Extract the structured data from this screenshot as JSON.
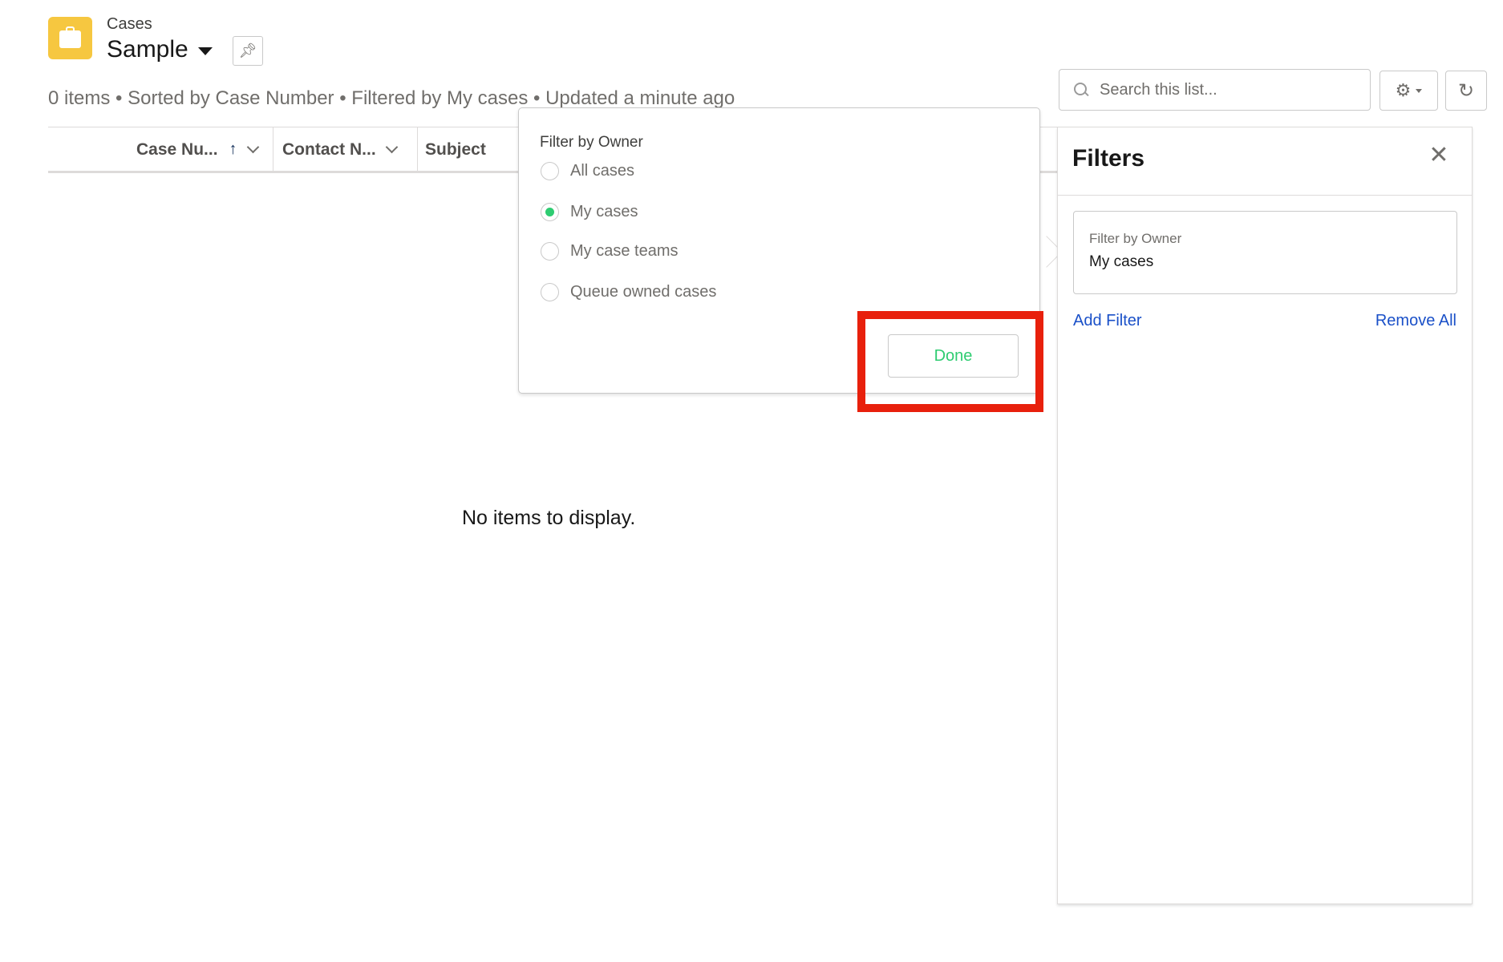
{
  "header": {
    "object_label": "Cases",
    "list_view_name": "Sample",
    "pin_icon": "pin-icon"
  },
  "meta": {
    "summary": "0 items • Sorted by Case Number • Filtered by My cases • Updated a minute ago"
  },
  "toolbar": {
    "search_placeholder": "Search this list...",
    "gear_icon": "gear-icon",
    "refresh_icon": "refresh-icon"
  },
  "table": {
    "columns": [
      {
        "label": "Case Nu...",
        "sorted": "ascending"
      },
      {
        "label": "Contact N..."
      },
      {
        "label": "Subject"
      }
    ],
    "empty_message": "No items to display."
  },
  "popover": {
    "title": "Filter by Owner",
    "options": [
      {
        "label": "All cases",
        "checked": false
      },
      {
        "label": "My cases",
        "checked": true
      },
      {
        "label": "My case teams",
        "checked": false
      },
      {
        "label": "Queue owned cases",
        "checked": false
      }
    ],
    "done_label": "Done"
  },
  "filters_panel": {
    "title": "Filters",
    "filter_card": {
      "label": "Filter by Owner",
      "value": "My cases"
    },
    "add_filter_label": "Add Filter",
    "remove_all_label": "Remove All"
  },
  "colors": {
    "app_icon": "#f6c740",
    "accent_green": "#2ecc71",
    "link_blue": "#1a50c8",
    "highlight_red": "#e8200c"
  }
}
